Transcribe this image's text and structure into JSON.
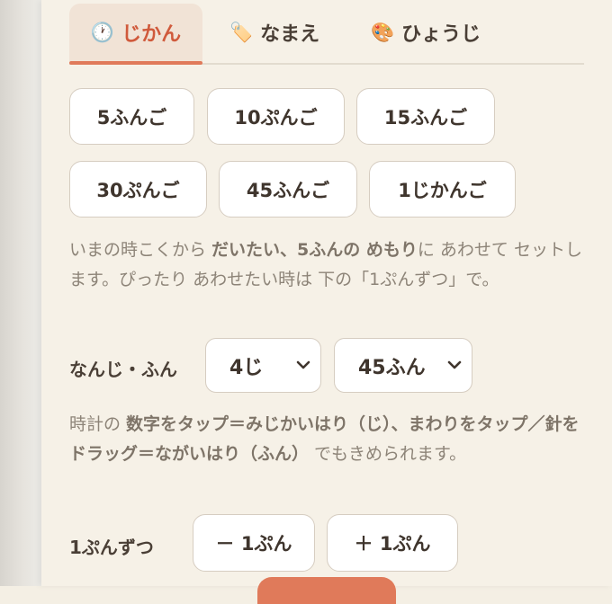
{
  "tabs": [
    {
      "icon": "🕐",
      "label": "じかん",
      "active": true
    },
    {
      "icon": "🏷️",
      "label": "なまえ",
      "active": false
    },
    {
      "icon": "🎨",
      "label": "ひょうじ",
      "active": false
    }
  ],
  "presets": [
    "5ふんご",
    "10ぷんご",
    "15ふんご",
    "30ぷんご",
    "45ふんご",
    "1じかんご"
  ],
  "info1": {
    "p1": "いまの時こくから ",
    "b1": "だいたい、5ふんの めもり",
    "p2": "に あわせて セットします。ぴったり あわせたい時は 下の「1ぷんずつ」で。"
  },
  "time_select": {
    "label": "なんじ・ふん",
    "hour": "4じ",
    "minute": "45ふん"
  },
  "info2": {
    "p1": "時計の ",
    "b1": "数字をタップ＝みじかいはり（じ）、まわりをタップ／針をドラッグ＝ながいはり（ふん）",
    "p2": " でもきめられます。"
  },
  "step": {
    "label": "1ぷんずつ",
    "minus": "－ 1ぷん",
    "plus": "＋ 1ぷん"
  },
  "colors": {
    "accent": "#e07a5a",
    "active_tab_text": "#d05a3c",
    "background": "#f6f1e7"
  }
}
